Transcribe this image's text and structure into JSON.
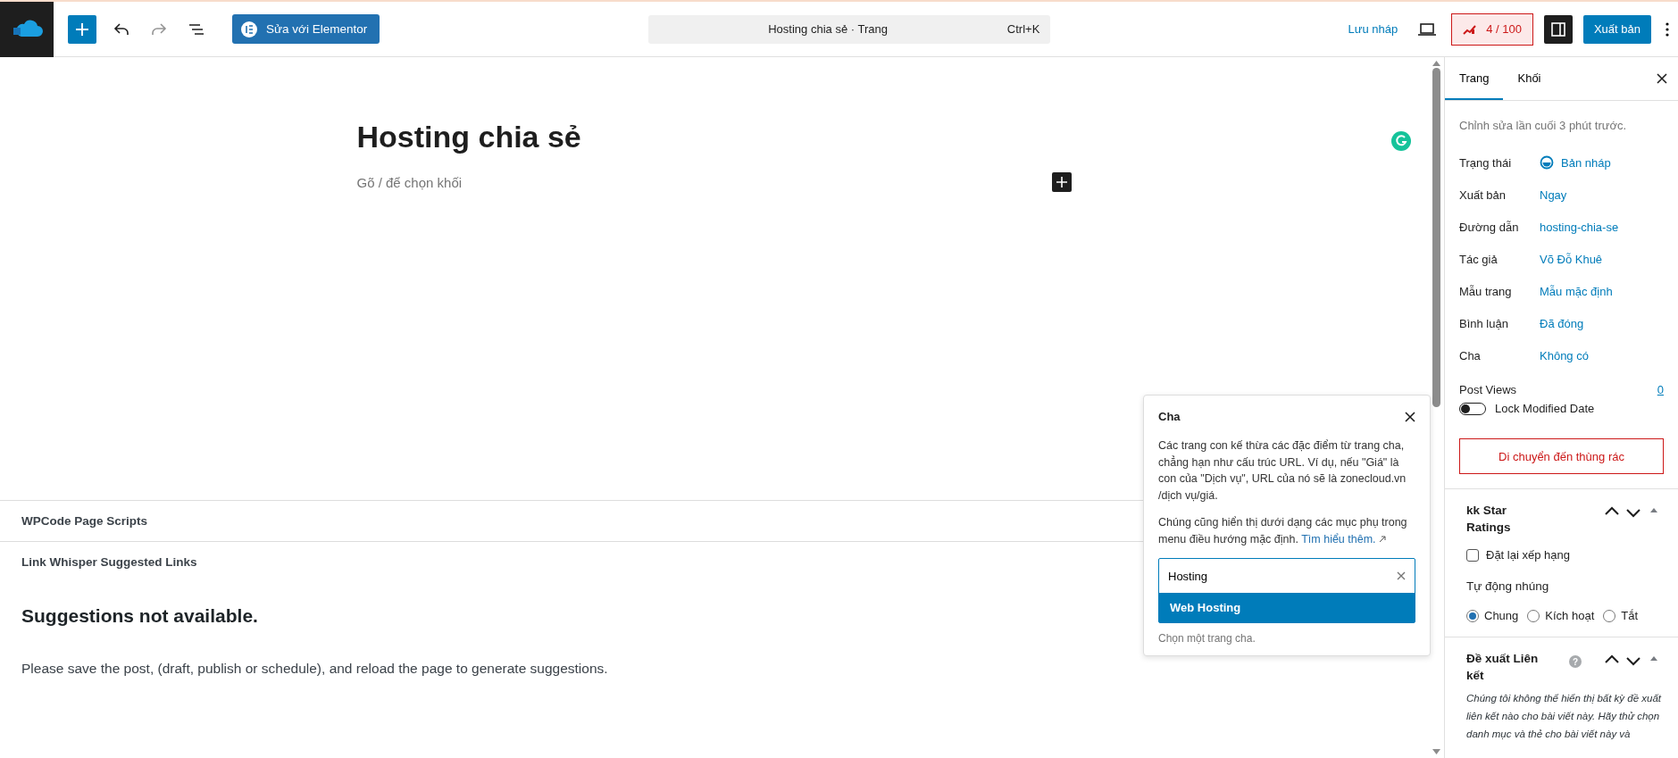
{
  "toolbar": {
    "edit_button": "Sửa với Elementor",
    "command_bar": {
      "title": "Hosting chia sẻ · Trang",
      "shortcut": "Ctrl+K"
    },
    "save_draft": "Lưu nháp",
    "seo_score": "4 / 100",
    "sidebar_toggle_pressed": true,
    "publish": "Xuất bản"
  },
  "editor": {
    "title": "Hosting chia sẻ",
    "block_placeholder": "Gõ / để chọn khối"
  },
  "meta_boxes": [
    {
      "title": "WPCode Page Scripts"
    },
    {
      "title": "Link Whisper Suggested Links"
    }
  ],
  "link_whisper": {
    "heading": "Suggestions not available.",
    "message": "Please save the post, (draft, publish or schedule), and reload the page to generate suggestions."
  },
  "parent_popover": {
    "title": "Cha",
    "description": "Các trang con kế thừa các đặc điểm từ trang cha, chẳng hạn như cấu trúc URL. Ví dụ, nếu \"Giá\" là con của \"Dịch vụ\", URL của nó sẽ là zonecloud.vn /dịch vụ/giá.",
    "note": "Chúng cũng hiển thị dưới dạng các mục phụ trong menu điều hướng mặc định.",
    "link": "Tìm hiểu thêm.",
    "search_value": "Hosting",
    "suggestions": [
      {
        "label": "Web Hosting",
        "selected": true
      }
    ],
    "help": "Chọn một trang cha."
  },
  "sidebar": {
    "tabs": [
      {
        "label": "Trang",
        "selected": true
      },
      {
        "label": "Khối",
        "selected": false
      }
    ],
    "last_edited": "Chỉnh sửa lần cuối 3 phút trước.",
    "fields": [
      {
        "label": "Trạng thái",
        "value": "Bản nháp",
        "kind": "status"
      },
      {
        "label": "Xuất bản",
        "value": "Ngay",
        "kind": "link"
      },
      {
        "label": "Đường dẫn",
        "value": "hosting-chia-se",
        "kind": "link"
      },
      {
        "label": "Tác giả",
        "value": "Võ Đỗ Khuê",
        "kind": "link"
      },
      {
        "label": "Mẫu trang",
        "value": "Mẫu mặc định",
        "kind": "link"
      },
      {
        "label": "Bình luận",
        "value": "Đã đóng",
        "kind": "link"
      },
      {
        "label": "Cha",
        "value": "Không có",
        "kind": "link"
      }
    ],
    "post_views": {
      "label": "Post Views",
      "value": "0"
    },
    "lock_modified": {
      "label": "Lock Modified Date",
      "on": false
    },
    "trash": "Di chuyển đến thùng rác",
    "star_ratings": {
      "title": "kk Star Ratings",
      "reset": {
        "label": "Đặt lại xếp hạng",
        "checked": false
      },
      "auto_embed_label": "Tự động nhúng",
      "options": [
        {
          "label": "Chung",
          "selected": true
        },
        {
          "label": "Kích hoạt",
          "selected": false
        },
        {
          "label": "Tắt",
          "selected": false
        }
      ]
    },
    "link_suggestions": {
      "title": "Đề xuất Liên kết",
      "help_mark": "?",
      "text": "Chúng tôi không thể hiển thị bất kỳ đề xuất liên kết nào cho bài viết này. Hãy thử chọn danh mục và thẻ cho bài viết này và"
    }
  }
}
